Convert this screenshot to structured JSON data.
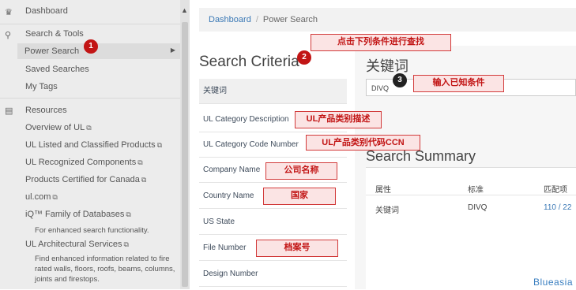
{
  "sidebar": {
    "dashboard": "Dashboard",
    "search_tools": "Search & Tools",
    "power_search": "Power Search",
    "saved_searches": "Saved Searches",
    "my_tags": "My Tags",
    "resources": "Resources",
    "overview": "Overview of UL",
    "listed_classified": "UL Listed and Classified Products",
    "recognized": "UL Recognized Components",
    "certified_canada": "Products Certified for Canada",
    "ulcom": "ul.com",
    "iq_family": "iQ™ Family of Databases",
    "iq_desc": "For enhanced search functionality.",
    "architectural": "UL Architectural Services",
    "arch_desc": "Find enhanced information related to fire rated walls, floors, roofs, beams, columns, joints and firestops."
  },
  "breadcrumb": {
    "home": "Dashboard",
    "sep": "/",
    "current": "Power Search"
  },
  "criteria": {
    "title": "Search Criteria",
    "items": [
      "关键词",
      "UL Category Description",
      "UL Category Code Number",
      "Company Name",
      "Country Name",
      "US State",
      "File Number",
      "Design Number"
    ]
  },
  "keyword": {
    "title": "关键词",
    "value": "DIVQ"
  },
  "summary": {
    "title": "Search Summary",
    "headers": [
      "属性",
      "标准",
      "匹配项"
    ],
    "row": [
      "关键词",
      "DIVQ",
      "110 / 22"
    ]
  },
  "annotations": {
    "a1": "点击下列条件进行查找",
    "a2": "输入已知条件",
    "a3": "UL产品类别描述",
    "a4": "UL产品类别代码CCN",
    "a5": "公司名称",
    "a6": "国家",
    "a7": "档案号",
    "n1": "1",
    "n2": "2",
    "n3": "3"
  },
  "watermark": "Blueasia"
}
